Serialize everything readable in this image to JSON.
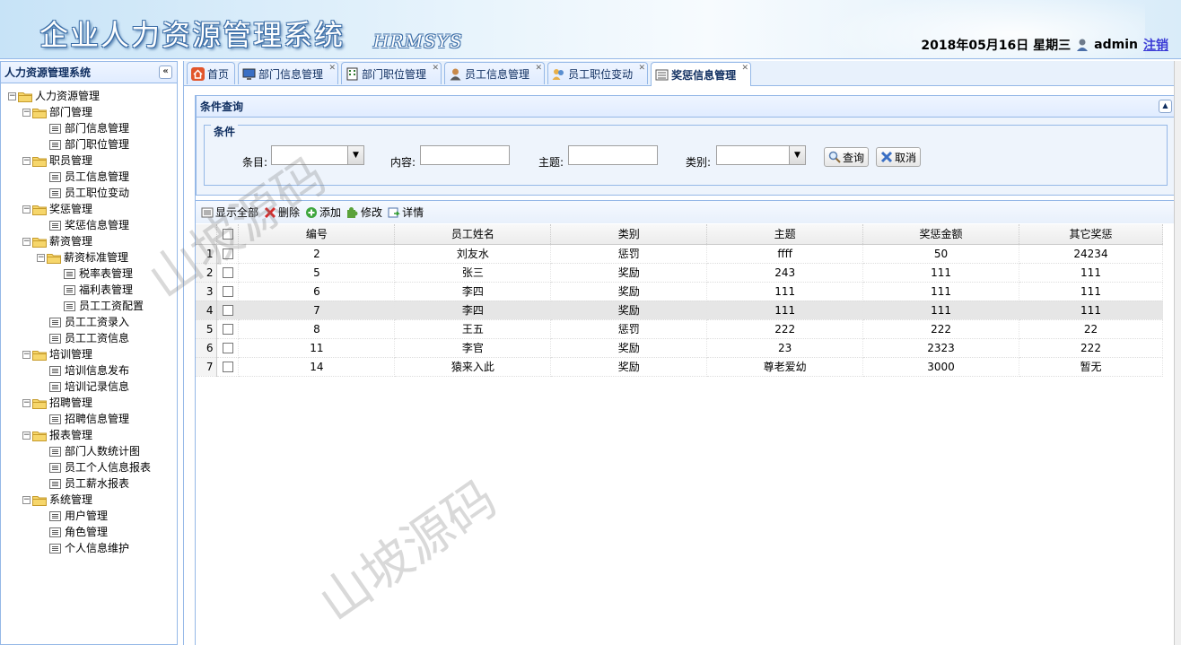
{
  "header": {
    "title": "企业人力资源管理系统",
    "subtitle": "HRMSYS",
    "date": "2018年05月16日 星期三",
    "user": "admin",
    "logout": "注销"
  },
  "west": {
    "title": "人力资源管理系统",
    "collapse": "«",
    "tree": [
      {
        "label": "人力资源管理",
        "level": 0,
        "kind": "folder"
      },
      {
        "label": "部门管理",
        "level": 1,
        "kind": "folder"
      },
      {
        "label": "部门信息管理",
        "level": 2,
        "kind": "file"
      },
      {
        "label": "部门职位管理",
        "level": 2,
        "kind": "file"
      },
      {
        "label": "职员管理",
        "level": 1,
        "kind": "folder"
      },
      {
        "label": "员工信息管理",
        "level": 2,
        "kind": "file"
      },
      {
        "label": "员工职位变动",
        "level": 2,
        "kind": "file"
      },
      {
        "label": "奖惩管理",
        "level": 1,
        "kind": "folder"
      },
      {
        "label": "奖惩信息管理",
        "level": 2,
        "kind": "file"
      },
      {
        "label": "薪资管理",
        "level": 1,
        "kind": "folder"
      },
      {
        "label": "薪资标准管理",
        "level": 2,
        "kind": "folder"
      },
      {
        "label": "税率表管理",
        "level": 3,
        "kind": "file"
      },
      {
        "label": "福利表管理",
        "level": 3,
        "kind": "file"
      },
      {
        "label": "员工工资配置",
        "level": 3,
        "kind": "file"
      },
      {
        "label": "员工工资录入",
        "level": 2,
        "kind": "file"
      },
      {
        "label": "员工工资信息",
        "level": 2,
        "kind": "file"
      },
      {
        "label": "培训管理",
        "level": 1,
        "kind": "folder"
      },
      {
        "label": "培训信息发布",
        "level": 2,
        "kind": "file"
      },
      {
        "label": "培训记录信息",
        "level": 2,
        "kind": "file"
      },
      {
        "label": "招聘管理",
        "level": 1,
        "kind": "folder"
      },
      {
        "label": "招聘信息管理",
        "level": 2,
        "kind": "file"
      },
      {
        "label": "报表管理",
        "level": 1,
        "kind": "folder"
      },
      {
        "label": "部门人数统计图",
        "level": 2,
        "kind": "file"
      },
      {
        "label": "员工个人信息报表",
        "level": 2,
        "kind": "file"
      },
      {
        "label": "员工薪水报表",
        "level": 2,
        "kind": "file"
      },
      {
        "label": "系统管理",
        "level": 1,
        "kind": "folder"
      },
      {
        "label": "用户管理",
        "level": 2,
        "kind": "file"
      },
      {
        "label": "角色管理",
        "level": 2,
        "kind": "file"
      },
      {
        "label": "个人信息维护",
        "level": 2,
        "kind": "file"
      }
    ]
  },
  "tabs": [
    {
      "label": "首页",
      "icon": "home-icon",
      "closable": false
    },
    {
      "label": "部门信息管理",
      "icon": "monitor-icon",
      "closable": true
    },
    {
      "label": "部门职位管理",
      "icon": "building-icon",
      "closable": true
    },
    {
      "label": "员工信息管理",
      "icon": "user-icon",
      "closable": true
    },
    {
      "label": "员工职位变动",
      "icon": "users-icon",
      "closable": true
    },
    {
      "label": "奖惩信息管理",
      "icon": "list-icon",
      "closable": true,
      "active": true
    }
  ],
  "query": {
    "panel_title": "条件查询",
    "legend": "条件",
    "item_label": "条目:",
    "content_label": "内容:",
    "subject_label": "主题:",
    "type_label": "类别:",
    "search_button": "查询",
    "cancel_button": "取消"
  },
  "toolbar": {
    "show_all": "显示全部",
    "delete": "删除",
    "add": "添加",
    "edit": "修改",
    "detail": "详情"
  },
  "grid": {
    "columns": [
      "编号",
      "员工姓名",
      "类别",
      "主题",
      "奖惩金额",
      "其它奖惩"
    ],
    "rows": [
      {
        "rn": "1",
        "cells": [
          "2",
          "刘友水",
          "惩罚",
          "ffff",
          "50",
          "24234"
        ]
      },
      {
        "rn": "2",
        "cells": [
          "5",
          "张三",
          "奖励",
          "243",
          "111",
          "111"
        ]
      },
      {
        "rn": "3",
        "cells": [
          "6",
          "李四",
          "奖励",
          "111",
          "111",
          "111"
        ]
      },
      {
        "rn": "4",
        "cells": [
          "7",
          "李四",
          "奖励",
          "111",
          "111",
          "111"
        ],
        "highlight": true
      },
      {
        "rn": "5",
        "cells": [
          "8",
          "王五",
          "惩罚",
          "222",
          "222",
          "22"
        ]
      },
      {
        "rn": "6",
        "cells": [
          "11",
          "李官",
          "奖励",
          "23",
          "2323",
          "222"
        ]
      },
      {
        "rn": "7",
        "cells": [
          "14",
          "猿来入此",
          "奖励",
          "尊老爱幼",
          "3000",
          "暂无"
        ]
      }
    ]
  },
  "watermark": "山坡源码"
}
